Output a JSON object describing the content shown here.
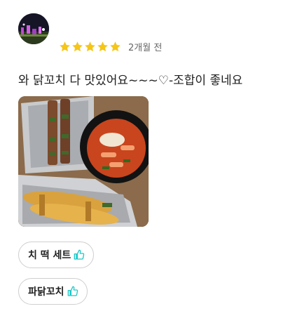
{
  "review": {
    "rating": 5,
    "rating_max": 5,
    "date": "2개월 전",
    "text": "와 닭꼬치 다 맛있어요~~~♡-조합이 좋네요"
  },
  "tags": [
    {
      "label": "치 떡 세트",
      "icon": "thumbs-up-icon"
    },
    {
      "label": "파닭꼬치",
      "icon": "thumbs-up-icon"
    }
  ],
  "colors": {
    "star": "#F5C518",
    "thumb": "#1EC8C8",
    "tag_border": "#CFCFCF"
  }
}
